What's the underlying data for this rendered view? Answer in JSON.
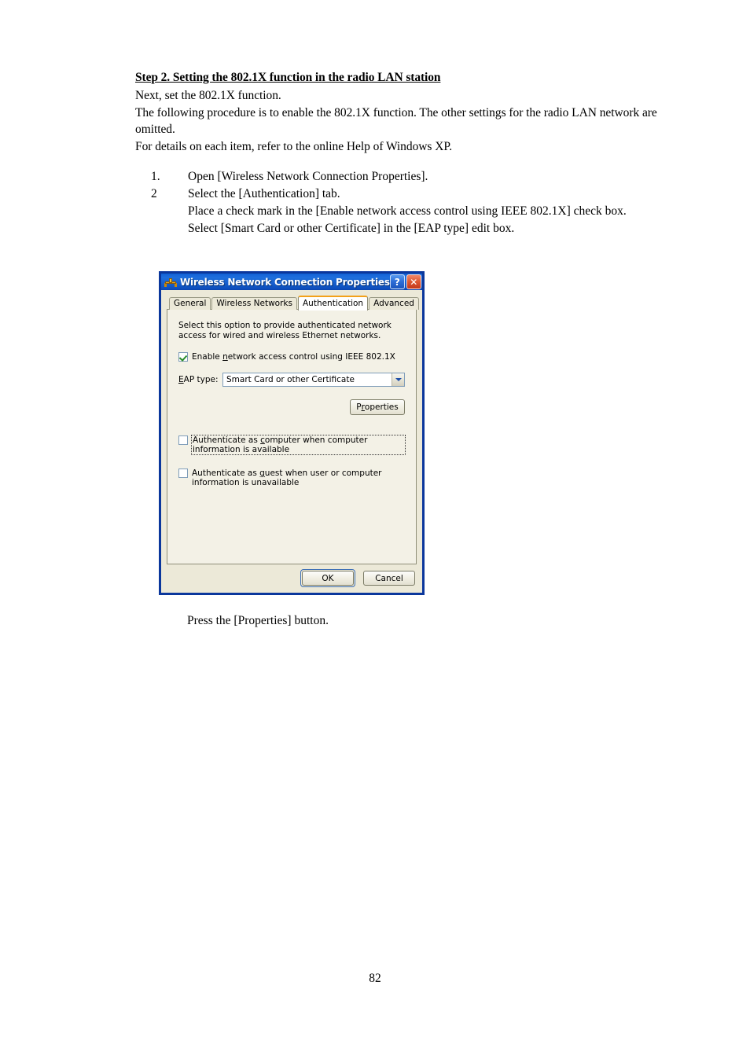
{
  "document": {
    "step_heading": "Step 2.  Setting the 802.1X function in the radio LAN station",
    "para1": "Next, set the 802.1X function.",
    "para2": "The following procedure is to enable the 802.1X function.  The other settings for the radio LAN network are omitted.",
    "para3": "For details on each item, refer to the online Help of Windows XP.",
    "steps": [
      {
        "num": "1.",
        "text": "Open [Wireless Network Connection Properties]."
      },
      {
        "num": "2",
        "text": "Select the [Authentication] tab."
      }
    ],
    "step2_sub1": "Place a check mark in the [Enable network access control using IEEE 802.1X] check box.",
    "step2_sub2": "Select [Smart Card or other Certificate] in the [EAP type] edit box.",
    "press_note": "Press the [Properties] button.",
    "page_number": "82"
  },
  "dialog": {
    "title": "Wireless Network Connection Properties",
    "title_icon": "network-adapter-icon",
    "help_button": "?",
    "close_button": "✕",
    "tabs": [
      {
        "label": "General",
        "active": false
      },
      {
        "label": "Wireless Networks",
        "active": false
      },
      {
        "label": "Authentication",
        "active": true
      },
      {
        "label": "Advanced",
        "active": false
      }
    ],
    "panel": {
      "description": "Select this option to provide authenticated network access for wired and wireless Ethernet networks.",
      "enable_checkbox": {
        "label_pre": "Enable ",
        "label_accel": "n",
        "label_post": "etwork access control using IEEE 802.1X",
        "checked": true
      },
      "eap": {
        "label_accel": "E",
        "label_post": "AP type:",
        "value": "Smart Card or other Certificate"
      },
      "properties_button": {
        "label_pre": "P",
        "label_accel": "r",
        "label_post": "operties"
      },
      "auth_computer_checkbox": {
        "label_pre": "Authenticate as ",
        "label_accel": "c",
        "label_post": "omputer when computer information is available",
        "checked": false,
        "focused": true
      },
      "auth_guest_checkbox": {
        "label_pre": "Authenticate as ",
        "label_accel": "g",
        "label_post": "uest when user or computer information is unavailable",
        "checked": false,
        "focused": false
      }
    },
    "ok_button": "OK",
    "cancel_button": "Cancel"
  },
  "colors": {
    "titlebar_blue": "#1866d8",
    "dialog_border": "#0b379c",
    "dialog_face": "#ece9d8",
    "tab_active_accent": "#f3a11a",
    "checkmark_green": "#2a8c2a",
    "close_red": "#c3381a"
  }
}
